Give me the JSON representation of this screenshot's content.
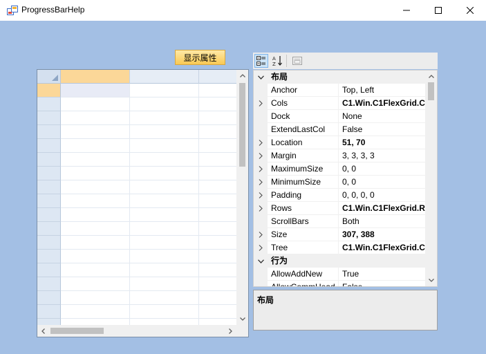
{
  "window": {
    "title": "ProgressBarHelp",
    "minimize_glyph": "─",
    "maximize_glyph": "☐",
    "close_glyph": "✕"
  },
  "colors": {
    "client_background": "#a3bfe4",
    "selected_header": "#fbd798",
    "button_gradient_top": "#ffe9a6",
    "button_gradient_bottom": "#f9c954"
  },
  "button": {
    "show_properties_label": "显示属性"
  },
  "property_grid": {
    "toolbar": {
      "categorized_icon": "categorized-icon",
      "alphabetical_icon": "alphabetical-icon",
      "property_pages_icon": "property-pages-icon",
      "alphabetical_glyph_a": "A",
      "alphabetical_glyph_z": "Z"
    },
    "rows": [
      {
        "type": "category",
        "label": "布局",
        "expanded": true
      },
      {
        "type": "prop",
        "name": "Anchor",
        "value": "Top, Left",
        "bold": false,
        "expandable": false
      },
      {
        "type": "prop",
        "name": "Cols",
        "value": "C1.Win.C1FlexGrid.C",
        "bold": true,
        "expandable": true
      },
      {
        "type": "prop",
        "name": "Dock",
        "value": "None",
        "bold": false,
        "expandable": false
      },
      {
        "type": "prop",
        "name": "ExtendLastCol",
        "value": "False",
        "bold": false,
        "expandable": false
      },
      {
        "type": "prop",
        "name": "Location",
        "value": "51, 70",
        "bold": true,
        "expandable": true
      },
      {
        "type": "prop",
        "name": "Margin",
        "value": "3, 3, 3, 3",
        "bold": false,
        "expandable": true
      },
      {
        "type": "prop",
        "name": "MaximumSize",
        "value": "0, 0",
        "bold": false,
        "expandable": true
      },
      {
        "type": "prop",
        "name": "MinimumSize",
        "value": "0, 0",
        "bold": false,
        "expandable": true
      },
      {
        "type": "prop",
        "name": "Padding",
        "value": "0, 0, 0, 0",
        "bold": false,
        "expandable": true
      },
      {
        "type": "prop",
        "name": "Rows",
        "value": "C1.Win.C1FlexGrid.R",
        "bold": true,
        "expandable": true
      },
      {
        "type": "prop",
        "name": "ScrollBars",
        "value": "Both",
        "bold": false,
        "expandable": false
      },
      {
        "type": "prop",
        "name": "Size",
        "value": "307, 388",
        "bold": true,
        "expandable": true
      },
      {
        "type": "prop",
        "name": "Tree",
        "value": "C1.Win.C1FlexGrid.C",
        "bold": true,
        "expandable": true
      },
      {
        "type": "category",
        "label": "行为",
        "expanded": true
      },
      {
        "type": "prop",
        "name": "AllowAddNew",
        "value": "True",
        "bold": false,
        "expandable": false
      },
      {
        "type": "prop",
        "name": "AllowCommHead",
        "value": "False",
        "bold": false,
        "expandable": false
      }
    ],
    "description_title": "布局"
  },
  "flex_grid": {
    "columns": 3,
    "rows": 18,
    "selected_row": 0,
    "selected_col": 0,
    "cells": []
  }
}
